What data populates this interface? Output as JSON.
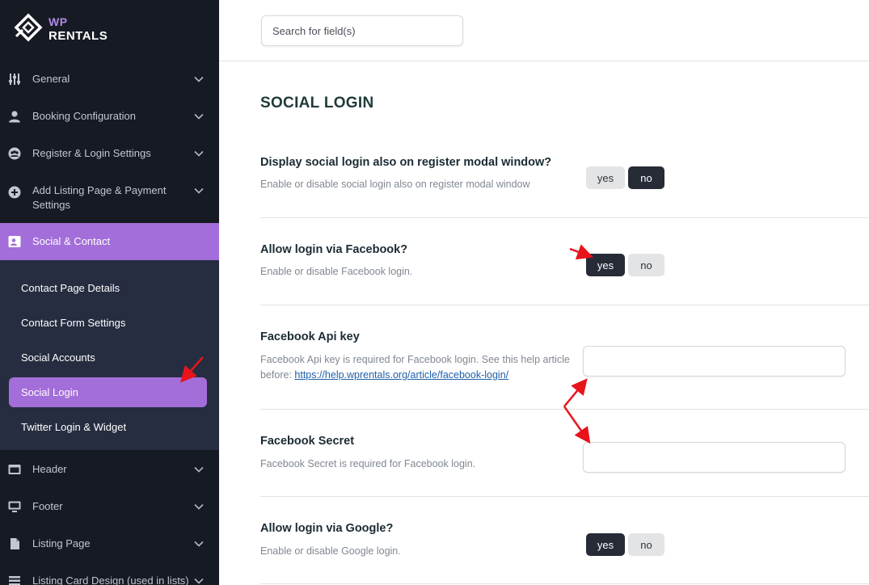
{
  "brand": {
    "line1": "WP",
    "line2": "RENTALS"
  },
  "sidebar": {
    "items": [
      {
        "label": "General",
        "icon": "sliders-icon"
      },
      {
        "label": "Booking Configuration",
        "icon": "user-icon"
      },
      {
        "label": "Register & Login Settings",
        "icon": "users-icon"
      },
      {
        "label": "Add Listing Page & Payment Settings",
        "icon": "plus-circle-icon"
      },
      {
        "label": "Social & Contact",
        "icon": "contact-card-icon"
      },
      {
        "label": "Header",
        "icon": "window-icon"
      },
      {
        "label": "Footer",
        "icon": "monitor-icon"
      },
      {
        "label": "Listing Page",
        "icon": "file-icon"
      },
      {
        "label": "Listing Card Design (used in lists)",
        "icon": "list-icon"
      }
    ],
    "subitems": [
      {
        "label": "Contact Page Details"
      },
      {
        "label": "Contact Form Settings"
      },
      {
        "label": "Social Accounts"
      },
      {
        "label": "Social Login"
      },
      {
        "label": "Twitter Login & Widget"
      }
    ]
  },
  "search": {
    "placeholder": "Search for field(s)"
  },
  "page": {
    "title": "SOCIAL LOGIN"
  },
  "fields": [
    {
      "title": "Display social login also on register modal window?",
      "desc": "Enable or disable social login also on register modal window",
      "selected": "no"
    },
    {
      "title": "Allow login via Facebook?",
      "desc": "Enable or disable Facebook login.",
      "selected": "yes"
    },
    {
      "title": "Facebook Api key",
      "desc": "Facebook Api key is required for Facebook login. See this help article before: ",
      "link": "https://help.wprentals.org/article/facebook-login/",
      "value": ""
    },
    {
      "title": "Facebook Secret",
      "desc": "Facebook Secret is required for Facebook login.",
      "value": ""
    },
    {
      "title": "Allow login via Google?",
      "desc": "Enable or disable Google login.",
      "selected": "yes"
    }
  ],
  "toggle_labels": {
    "yes": "yes",
    "no": "no"
  },
  "colors": {
    "sidebar_bg": "#161a23",
    "submenu_bg": "#262d40",
    "accent": "#a36ed9",
    "toggle_on": "#262b36",
    "annotation": "#e8141b"
  }
}
